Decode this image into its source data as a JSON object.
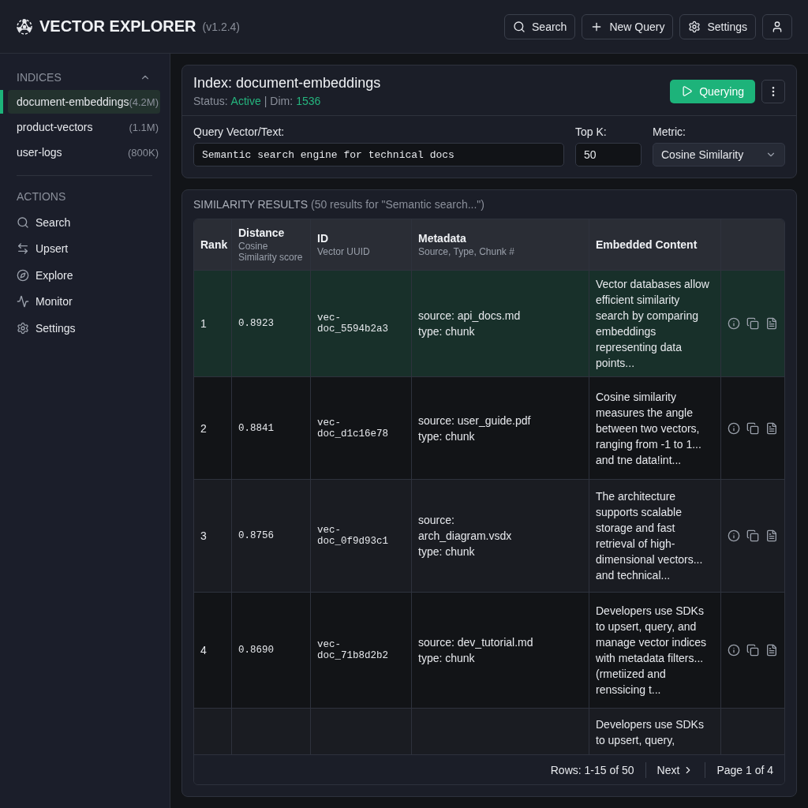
{
  "app": {
    "title": "VECTOR EXPLORER",
    "version": "(v1.2.4)"
  },
  "header_buttons": [
    {
      "kind": "search",
      "label": "Search"
    },
    {
      "kind": "new",
      "label": "New Query"
    },
    {
      "kind": "settings",
      "label": "Settings"
    },
    {
      "kind": "user"
    }
  ],
  "sidebar": {
    "indices_title": "INDICES",
    "indices_expanded": true,
    "indices": [
      {
        "name": "document-embeddings",
        "count": "(4.2M)",
        "selected": true
      },
      {
        "name": "product-vectors",
        "count": "(1.1M)",
        "selected": false
      },
      {
        "name": "user-logs",
        "count": "(800K)",
        "selected": false
      }
    ],
    "actions_title": "ACTIONS",
    "actions": [
      {
        "kind": "search",
        "label": "Search"
      },
      {
        "kind": "upsert",
        "label": "Upsert"
      },
      {
        "kind": "explore",
        "label": "Explore"
      },
      {
        "kind": "monitor",
        "label": "Monitor"
      },
      {
        "kind": "settings",
        "label": "Settings"
      }
    ]
  },
  "index": {
    "title": "Index: document-embeddings",
    "status_label": "Status:",
    "status_value": "Active",
    "separator": "|",
    "dim_label": "Dim:",
    "dim_value": "1536",
    "run_button": "Querying"
  },
  "query": {
    "text_label": "Query Vector/Text:",
    "text_value": "Semantic search engine for technical docs",
    "topk_label": "Top K:",
    "topk_value": "50",
    "metric_label": "Metric:",
    "metric_value": "Cosine Similarity"
  },
  "results": {
    "title": "SIMILARITY RESULTS",
    "summary": "(50 results for \"Semantic search...\")",
    "columns": [
      {
        "title": "Rank"
      },
      {
        "title": "Distance",
        "subtitle": "Cosine Similarity score"
      },
      {
        "title": "ID",
        "subtitle": "Vector UUID"
      },
      {
        "title": "Metadata",
        "subtitle": "Source, Type, Chunk #"
      },
      {
        "title": "Embedded Content"
      }
    ],
    "rows": [
      {
        "rank": "1",
        "distance": "0.8923",
        "id": "vec-doc_5594b2a3",
        "metadata": [
          "source: api_docs.md",
          "type: chunk"
        ],
        "content": "Vector databases allow efficient similarity search by comparing embeddings representing data points...",
        "selected": true
      },
      {
        "rank": "2",
        "distance": "0.8841",
        "id": "vec-doc_d1c16e78",
        "metadata": [
          "source: user_guide.pdf",
          "type: chunk"
        ],
        "content": "Cosine similarity measures the angle between two vectors, ranging from -1 to 1... and tne data!int...",
        "selected": false
      },
      {
        "rank": "3",
        "distance": "0.8756",
        "id": "vec-doc_0f9d93c1",
        "metadata": [
          "source:",
          "arch_diagram.vsdx",
          "type: chunk"
        ],
        "content": "The architecture supports scalable storage and fast retrieval of high-dimensional vectors... and technical...",
        "selected": false
      },
      {
        "rank": "4",
        "distance": "0.8690",
        "id": "vec-doc_71b8d2b2",
        "metadata": [
          "source: dev_tutorial.md",
          "type: chunk"
        ],
        "content": "Developers use SDKs to upsert, query, and manage vector indices with metadata filters... (rmetiized and renssicing t...",
        "selected": false
      },
      {
        "content": "Developers use SDKs to upsert, query,",
        "selected": false
      }
    ],
    "footer": {
      "rows": "Rows: 1-15 of 50",
      "next": "Next",
      "page": "Page 1 of 4"
    }
  }
}
